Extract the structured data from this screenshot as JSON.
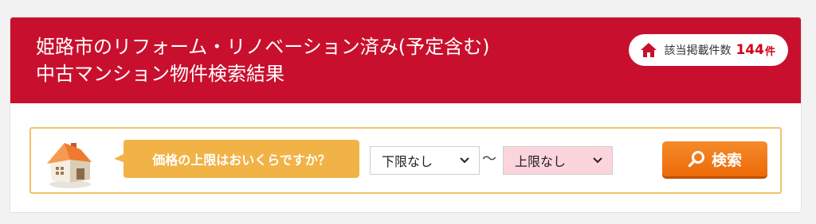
{
  "header": {
    "title_line1": "姫路市のリフォーム・リノベーション済み(予定含む)",
    "title_line2": "中古マンション物件検索結果",
    "count": {
      "label": "該当掲載件数",
      "value": "144",
      "unit": "件",
      "icon": "house-icon"
    }
  },
  "search": {
    "question": "価格の上限はおいくらですか？",
    "lower_select": {
      "value": "下限なし"
    },
    "separator": "～",
    "upper_select": {
      "value": "上限なし"
    },
    "button_label": "検索",
    "button_icon": "magnifier-icon"
  },
  "colors": {
    "brand_red": "#c8102e",
    "count_red": "#d0021b",
    "question_bg": "#f1b246",
    "button_orange": "#ee7309",
    "upper_select_bg": "#fcd4dc",
    "search_border": "#f0c36a"
  }
}
